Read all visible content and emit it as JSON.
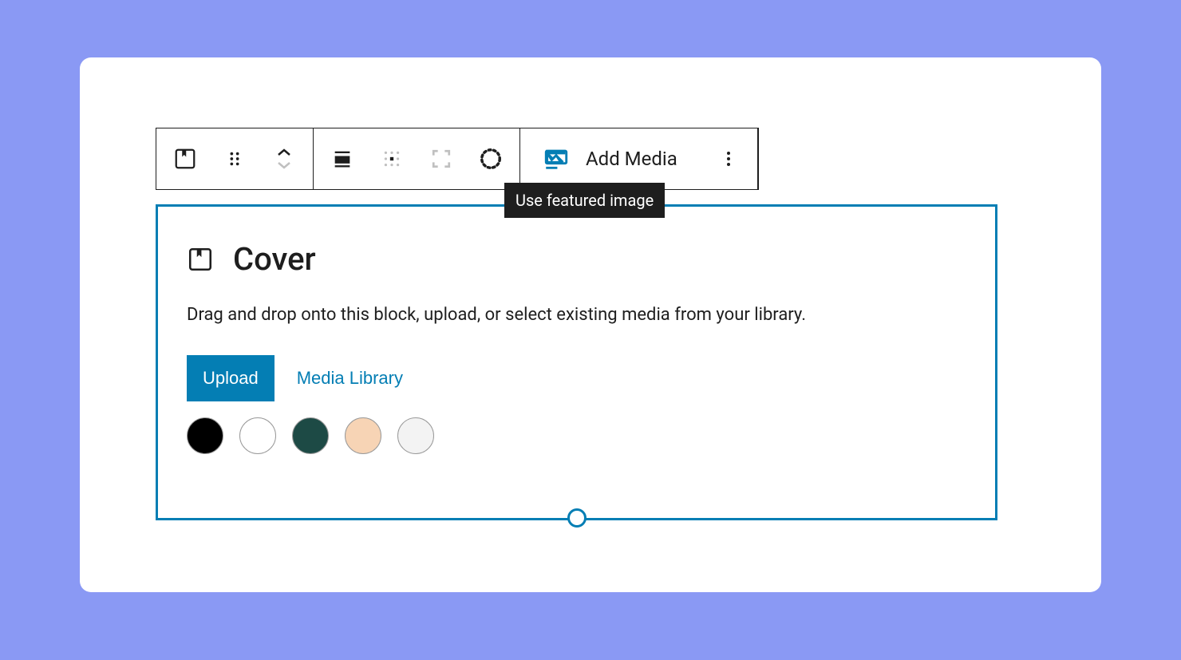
{
  "toolbar": {
    "add_media_label": "Add Media",
    "tooltip": "Use featured image"
  },
  "cover": {
    "title": "Cover",
    "description": "Drag and drop onto this block, upload, or select existing media from your library.",
    "upload_label": "Upload",
    "media_library_label": "Media Library",
    "swatches": [
      "#000000",
      "#ffffff",
      "#1d4a45",
      "#f7d4b5",
      "#f3f3f3"
    ]
  }
}
